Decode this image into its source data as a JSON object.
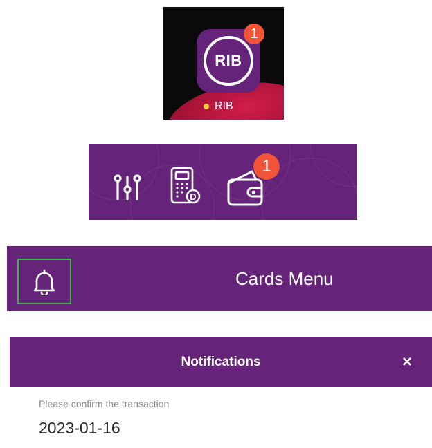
{
  "app_icon": {
    "monogram": "RIB",
    "badge_count": "1",
    "label": "RIB",
    "status_dot_color": "#f6d23a"
  },
  "toolbar": {
    "icons": [
      "sliders-icon",
      "card-reader-icon",
      "wallet-icon"
    ],
    "wallet_badge_count": "1"
  },
  "cards_header": {
    "bell_icon": "bell-icon",
    "title": "Cards Menu"
  },
  "notifications": {
    "title": "Notifications",
    "close_label": "×",
    "items": [
      {
        "message": "Please confirm the transaction",
        "date": "2023-01-16"
      }
    ]
  },
  "colors": {
    "brand_purple": "#66237a",
    "badge_red": "#f05337",
    "highlight_green": "#3bb64a"
  }
}
